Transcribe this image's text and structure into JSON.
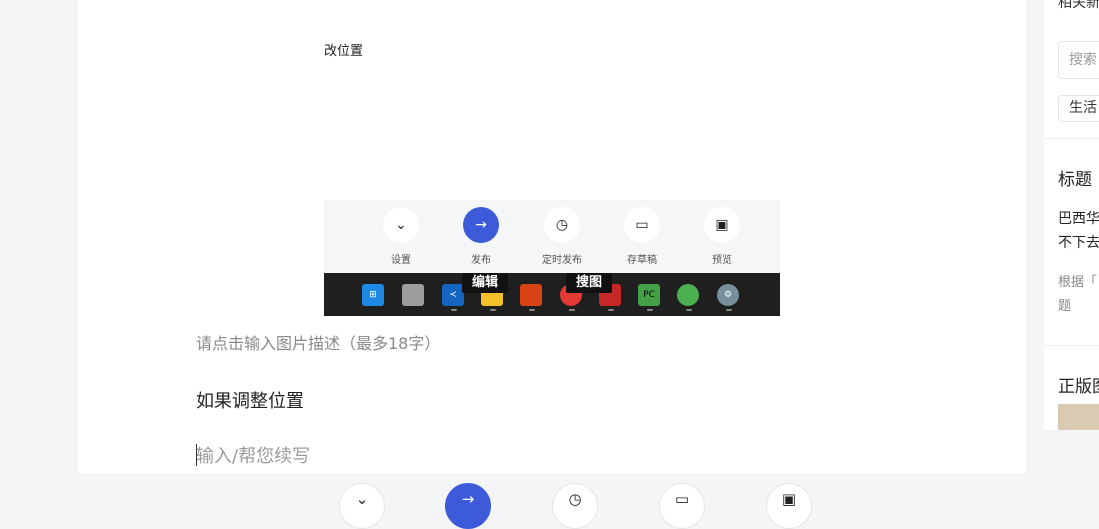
{
  "editor": {
    "image_top_text": "改位置",
    "image_actions": [
      {
        "label": "设置",
        "icon": "chevron-down-icon",
        "glyph": "⌄",
        "primary": false
      },
      {
        "label": "发布",
        "icon": "arrow-right-icon",
        "glyph": "→",
        "primary": true
      },
      {
        "label": "定时发布",
        "icon": "clock-icon",
        "glyph": "◷",
        "primary": false
      },
      {
        "label": "存草稿",
        "icon": "draft-icon",
        "glyph": "▭",
        "primary": false
      },
      {
        "label": "预览",
        "icon": "preview-icon",
        "glyph": "▣",
        "primary": false
      }
    ],
    "taskbar_tooltips": [
      "编辑",
      "搜图"
    ],
    "taskbar_icons": [
      "windows-start-icon",
      "task-view-icon",
      "vscode-icon",
      "file-explorer-icon",
      "app-icon",
      "chrome-icon",
      "app-icon",
      "pycharm-icon",
      "wechat-icon",
      "settings-icon"
    ],
    "image_caption_placeholder": "请点击输入图片描述（最多18字）",
    "paragraph": "如果调整位置",
    "continue_placeholder": "输入/帮您续写"
  },
  "sidebar": {
    "top_partial": "相关新",
    "search_placeholder": "搜索",
    "tag": "生活",
    "section_title": "标题",
    "title_item_line1": "巴西华",
    "title_item_line2": "不下去",
    "hint_line1": "根据「",
    "hint_line2": "题",
    "copyright_title": "正版图"
  },
  "bottom_bar": [
    {
      "icon": "chevron-down-icon",
      "glyph": "⌄",
      "primary": false
    },
    {
      "icon": "arrow-right-icon",
      "glyph": "→",
      "primary": true
    },
    {
      "icon": "clock-icon",
      "glyph": "◷",
      "primary": false
    },
    {
      "icon": "draft-icon",
      "glyph": "▭",
      "primary": false
    },
    {
      "icon": "preview-icon",
      "glyph": "▣",
      "primary": false
    }
  ],
  "colors": {
    "accent": "#3d5bd9",
    "background": "#f4f5f7",
    "taskbar": "#1f1f1f"
  }
}
